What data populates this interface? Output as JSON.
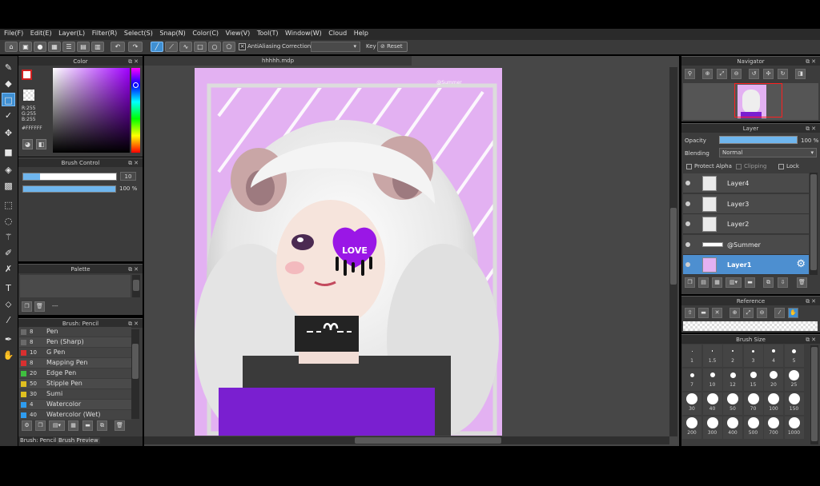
{
  "menu": [
    "File(F)",
    "Edit(E)",
    "Layer(L)",
    "Filter(R)",
    "Select(S)",
    "Snap(N)",
    "Color(C)",
    "View(V)",
    "Tool(T)",
    "Window(W)",
    "Cloud",
    "Help"
  ],
  "toolbar": {
    "antialiasing_label": "AntiAliasing",
    "correction_label": "Correction",
    "key_label": "Key",
    "reset_label": "Reset"
  },
  "document": {
    "tab_title": "hhhhh.mdp",
    "signature": "@Summer",
    "heart_text": "LOVE"
  },
  "color_panel": {
    "title": "Color",
    "rgb_r": "R:255",
    "rgb_g": "G:255",
    "rgb_b": "B:255",
    "hex": "#FFFFFF",
    "accent": "#3f8fd2"
  },
  "brush_control": {
    "title": "Brush Control",
    "size_value": "10",
    "opacity_value": "100",
    "opacity_unit": "%",
    "size_fraction": 0.18,
    "opacity_fraction": 1.0
  },
  "palette": {
    "title": "Palette",
    "dash": "---"
  },
  "brush_list": {
    "title": "Brush: Pencil",
    "items": [
      {
        "num": "8",
        "name": "Pen",
        "color": "#6a6a6a"
      },
      {
        "num": "8",
        "name": "Pen (Sharp)",
        "color": "#6a6a6a"
      },
      {
        "num": "10",
        "name": "G Pen",
        "color": "#d83030"
      },
      {
        "num": "8",
        "name": "Mapping Pen",
        "color": "#d83030"
      },
      {
        "num": "20",
        "name": "Edge Pen",
        "color": "#3fbf3f"
      },
      {
        "num": "50",
        "name": "Stipple Pen",
        "color": "#e0c020"
      },
      {
        "num": "30",
        "name": "Sumi",
        "color": "#e0c020"
      },
      {
        "num": "4",
        "name": "Watercolor",
        "color": "#2e9cf0"
      },
      {
        "num": "40",
        "name": "Watercolor (Wet)",
        "color": "#2e9cf0"
      }
    ],
    "tab1": "Brush: Pencil",
    "tab2": "Brush Preview"
  },
  "navigator": {
    "title": "Navigator"
  },
  "layer_panel": {
    "title": "Layer",
    "opacity_label": "Opacity",
    "opacity_value": "100 %",
    "blending_label": "Blending",
    "blending_value": "Normal",
    "protect_alpha": "Protect Alpha",
    "clipping": "Clipping",
    "lock": "Lock",
    "layers": [
      "Layer4",
      "Layer3",
      "Layer2",
      "@Summer",
      "Layer1"
    ],
    "selected_index": 4
  },
  "reference": {
    "title": "Reference"
  },
  "brush_size": {
    "title": "Brush Size",
    "sizes": [
      "1",
      "1.5",
      "2",
      "3",
      "4",
      "5",
      "7",
      "10",
      "12",
      "15",
      "20",
      "25",
      "30",
      "40",
      "50",
      "70",
      "100",
      "150",
      "200",
      "300",
      "400",
      "500",
      "700",
      "1000"
    ]
  }
}
